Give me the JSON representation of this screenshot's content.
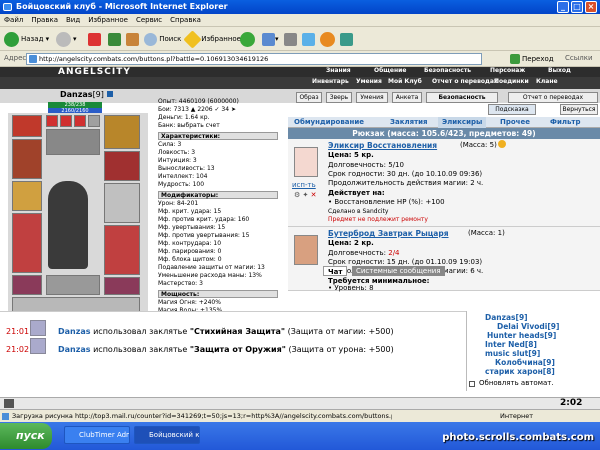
{
  "window": {
    "title": "Бойцовский клуб - Microsoft Internet Explorer"
  },
  "menu": [
    "Файл",
    "Правка",
    "Вид",
    "Избранное",
    "Сервис",
    "Справка"
  ],
  "toolbar": {
    "back": "Назад",
    "search": "Поиск",
    "favorites": "Избранное"
  },
  "address": {
    "label": "Адрес:",
    "url": "http://angelscity.combats.com/buttons.pl?battle=0.106913034619126",
    "go": "Переход",
    "links": "Ссылки"
  },
  "game": {
    "logo": "ANGELSCITY",
    "topnav": [
      {
        "label": "Знания",
        "row": 1,
        "col": 1
      },
      {
        "label": "Общение",
        "row": 1,
        "col": 2
      },
      {
        "label": "Безопасность",
        "row": 1,
        "col": 3
      },
      {
        "label": "Персонаж",
        "row": 1,
        "col": 4
      },
      {
        "label": "Выход",
        "row": 1,
        "col": 5
      },
      {
        "label": "Инвентарь",
        "row": 2,
        "col": 1
      },
      {
        "label": "Умения",
        "row": 2,
        "col": 2
      },
      {
        "label": "Мой Клуб",
        "row": 2,
        "col": 3
      },
      {
        "label": "Отчет о переводах",
        "row": 2,
        "col": 4
      },
      {
        "label": "Поединки",
        "row": 2,
        "col": 5
      },
      {
        "label": "Клане",
        "row": 2,
        "col": 6
      }
    ],
    "character": {
      "name": "Danzas",
      "level": "[9]",
      "hp": "238/238",
      "mp": "2160/2160"
    },
    "stats_top": [
      "Опыт: 4460109 (6000000)",
      "Бои: 7313 ▲ 2206 ✓ 34 ➤",
      "Деньги: 1.64 кр.",
      "Банк: выбрать счет"
    ],
    "characteristics_title": "Характеристики:",
    "characteristics": [
      "Сила: 3",
      "Ловкость: 3",
      "Интуиция: 3",
      "Выносливость: 13",
      "Интеллект: 104",
      "Мудрость: 100"
    ],
    "modifiers_title": "Модификаторы:",
    "modifiers": [
      "Урон: 84-201",
      "Мф. крит. удара: 15",
      "Мф. против крит. удара: 160",
      "Мф. увертывания: 15",
      "Мф. против увертывания: 15",
      "Мф. контрудара: 10",
      "Мф. парирования: 0",
      "Мф. блока щитом: 0",
      "Подавление защиты от магии: 13",
      "Уменьшение расхода маны: 13%",
      "Мастерство: 3"
    ],
    "power_title": "Мощность:",
    "power": [
      "Магия Огня: +240%",
      "Магия Воды: +135%"
    ],
    "buttons": [
      "Образ",
      "Зверь",
      "Умения",
      "Анкета",
      "Безопасность",
      "Отчет о переводах",
      "Подсказка",
      "Вернуться"
    ],
    "tabs": [
      "Обмундирование",
      "Заклятия",
      "Эликсиры",
      "Прочее",
      "Фильтр"
    ],
    "bag_header": "Рюкзак (масса: 105.6/423, предметов: 49)",
    "items": [
      {
        "name": "Эликсир Восстановления",
        "mass": "(Масса: 5)",
        "price": "Цена: 5 кр.",
        "durability": "Долговечность: 5/10",
        "expiry": "Срок годности: 30 дн. (до 10.10.09 09:36)",
        "duration": "Продолжительность действия магии: 2 ч.",
        "effects_title": "Действует на:",
        "effect": "• Восстановление НР (%): +100",
        "maker": "Сделано в Sandcity",
        "warn": "Предмет не подлежит ремонту",
        "use": "исп-ть"
      },
      {
        "name": "Бутерброд Завтрак Рыцаря",
        "mass": "(Масса: 1)",
        "price": "Цена: 2 кр.",
        "durability_label": "Долговечность: ",
        "durability_value": "2/4",
        "expiry": "Срок годности: 15 дн. (до 01.10.09 19:03)",
        "duration": "Продолжительность действия магии: 6 ч.",
        "req_title": "Требуется минимальное:",
        "req": "• Уровень: 8"
      }
    ],
    "chat_tabs": [
      "Чат",
      "Системные сообщения"
    ],
    "chat": [
      {
        "time": "21:01",
        "name": "Danzas",
        "text": " использовал заклятье ",
        "spell": "\"Стихийная Защита\"",
        "suffix": " (Защита от магии: +500)"
      },
      {
        "time": "21:02",
        "name": "Danzas",
        "text": " использовал заклятье ",
        "spell": "\"Защита от Оружия\"",
        "suffix": " (Защита от урона: +500)"
      }
    ],
    "users": [
      "Danzas[9]",
      "Delai Vivodi[9]",
      "Hunter heads[9]",
      "Inter Ned[8]",
      "music slut[9]",
      "Колобчина[9]",
      "старик харон[8]"
    ],
    "autoupdate": "Обновлять автомат.",
    "clock": "2:02"
  },
  "status": {
    "text": "Загрузка рисунка http://top3.mail.ru/counter?id=341269;t=50;js=13;r=http%3A//angelscity.combats.com/buttons.pl",
    "zone": "Интернет"
  },
  "taskbar": {
    "start": "пуск",
    "tasks": [
      "ClubTimer Administrat...",
      "Бойцовский клуб - М..."
    ],
    "watermark": "photo.scrolls.combats.com"
  }
}
